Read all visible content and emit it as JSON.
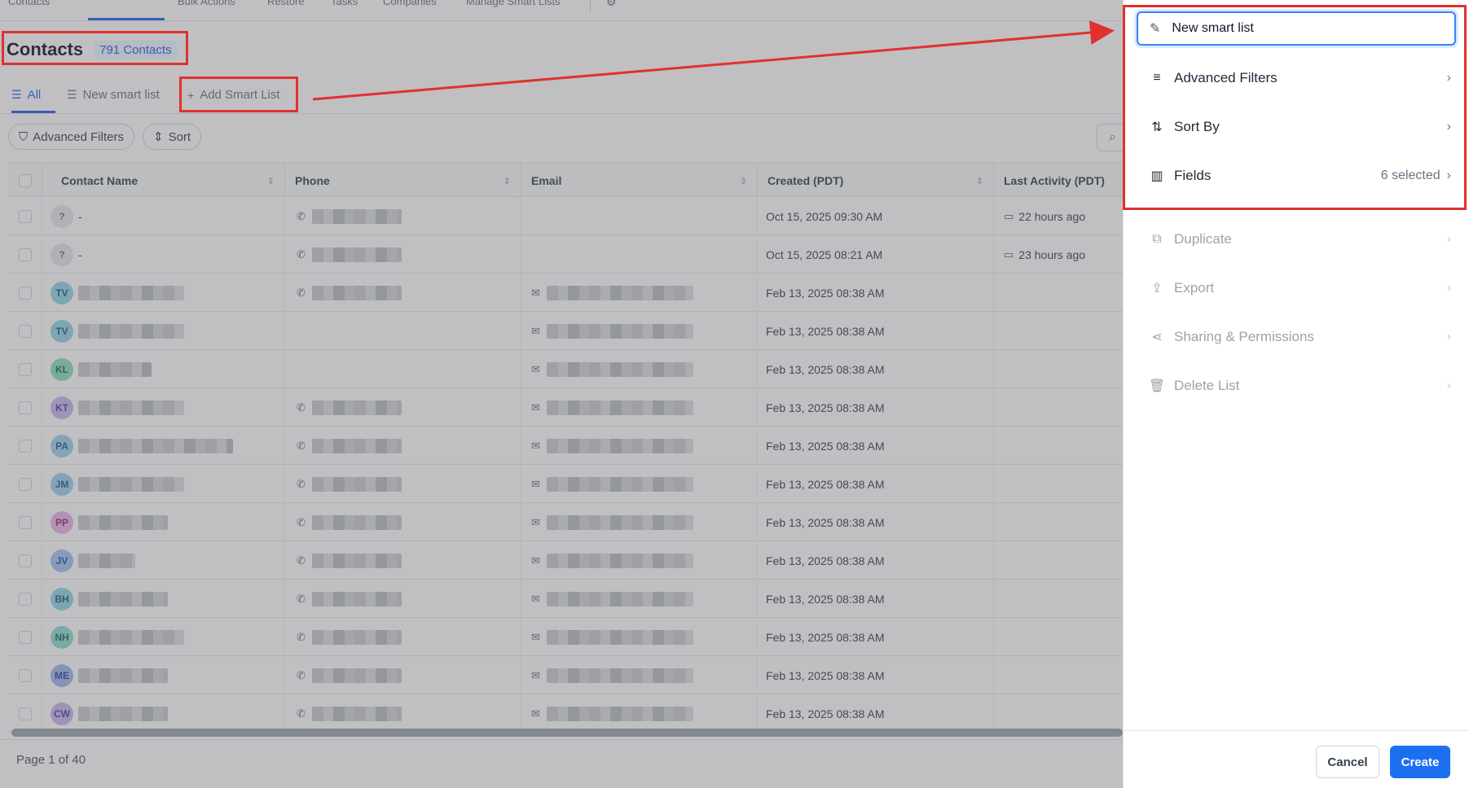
{
  "topnav": {
    "items": [
      "Contacts",
      "Bulk Actions",
      "Restore",
      "Tasks",
      "Companies",
      "Manage Smart Lists"
    ]
  },
  "header": {
    "title": "Contacts",
    "count": "791 Contacts"
  },
  "tabs": [
    {
      "label": "All",
      "icon": "list-icon"
    },
    {
      "label": "New smart list",
      "icon": "list-icon"
    },
    {
      "label": "Add Smart List",
      "icon": "plus-icon"
    }
  ],
  "filters": {
    "advanced": "Advanced Filters",
    "sort": "Sort"
  },
  "table": {
    "columns": [
      "Contact Name",
      "Phone",
      "Email",
      "Created (PDT)",
      "Last Activity (PDT)"
    ],
    "rows": [
      {
        "avatar": "?",
        "name": "-",
        "phone": true,
        "email": false,
        "created": "Oct 15, 2025 09:30 AM",
        "activity": "22 hours ago",
        "color": "#e5e7eb",
        "fg": "#6b7280"
      },
      {
        "avatar": "?",
        "name": "-",
        "phone": true,
        "email": false,
        "created": "Oct 15, 2025 08:21 AM",
        "activity": "23 hours ago",
        "color": "#e5e7eb",
        "fg": "#6b7280"
      },
      {
        "avatar": "TV",
        "name": "",
        "phone": true,
        "email": true,
        "created": "Feb 13, 2025 08:38 AM",
        "activity": "",
        "color": "#93d5e8",
        "fg": "#1e5f74"
      },
      {
        "avatar": "TV",
        "name": "",
        "phone": false,
        "email": true,
        "created": "Feb 13, 2025 08:38 AM",
        "activity": "",
        "color": "#93d5e8",
        "fg": "#1e5f74"
      },
      {
        "avatar": "KL",
        "name": "",
        "phone": false,
        "email": true,
        "created": "Feb 13, 2025 08:38 AM",
        "activity": "",
        "color": "#8fdcc2",
        "fg": "#1c6b52"
      },
      {
        "avatar": "KT",
        "name": "",
        "phone": true,
        "email": true,
        "created": "Feb 13, 2025 08:38 AM",
        "activity": "",
        "color": "#c9b8ee",
        "fg": "#5b3fa0"
      },
      {
        "avatar": "PA",
        "name": "",
        "phone": true,
        "email": true,
        "created": "Feb 13, 2025 08:38 AM",
        "activity": "",
        "color": "#9fd0f0",
        "fg": "#1f5f8b"
      },
      {
        "avatar": "JM",
        "name": "",
        "phone": true,
        "email": true,
        "created": "Feb 13, 2025 08:38 AM",
        "activity": "",
        "color": "#9fd0f0",
        "fg": "#1f5f8b"
      },
      {
        "avatar": "PP",
        "name": "",
        "phone": true,
        "email": true,
        "created": "Feb 13, 2025 08:38 AM",
        "activity": "",
        "color": "#eab5e6",
        "fg": "#8a2f83"
      },
      {
        "avatar": "JV",
        "name": "",
        "phone": true,
        "email": true,
        "created": "Feb 13, 2025 08:38 AM",
        "activity": "",
        "color": "#a3c4f2",
        "fg": "#2c5597"
      },
      {
        "avatar": "BH",
        "name": "",
        "phone": true,
        "email": true,
        "created": "Feb 13, 2025 08:38 AM",
        "activity": "",
        "color": "#93d5e8",
        "fg": "#1e5f74"
      },
      {
        "avatar": "NH",
        "name": "",
        "phone": true,
        "email": true,
        "created": "Feb 13, 2025 08:38 AM",
        "activity": "",
        "color": "#8fdcd2",
        "fg": "#1c6b62"
      },
      {
        "avatar": "ME",
        "name": "",
        "phone": true,
        "email": true,
        "created": "Feb 13, 2025 08:38 AM",
        "activity": "",
        "color": "#a3b8f2",
        "fg": "#2c4597"
      },
      {
        "avatar": "CW",
        "name": "",
        "phone": true,
        "email": true,
        "created": "Feb 13, 2025 08:38 AM",
        "activity": "",
        "color": "#c9b8ee",
        "fg": "#5b3fa0"
      }
    ]
  },
  "pagination": {
    "label": "Page 1 of 40"
  },
  "panel": {
    "name_value": "New smart list",
    "menu": [
      {
        "label": "Advanced Filters",
        "icon": "filter-lines-icon",
        "meta": "",
        "enabled": true
      },
      {
        "label": "Sort By",
        "icon": "sort-arrows-icon",
        "meta": "",
        "enabled": true
      },
      {
        "label": "Fields",
        "icon": "columns-icon",
        "meta": "6 selected",
        "enabled": true
      },
      {
        "label": "Duplicate",
        "icon": "copy-icon",
        "meta": "",
        "enabled": false
      },
      {
        "label": "Export",
        "icon": "upload-icon",
        "meta": "",
        "enabled": false
      },
      {
        "label": "Sharing & Permissions",
        "icon": "share-icon",
        "meta": "",
        "enabled": false
      },
      {
        "label": "Delete List",
        "icon": "trash-icon",
        "meta": "",
        "enabled": false
      }
    ],
    "cancel_label": "Cancel",
    "create_label": "Create"
  },
  "colors": {
    "accent": "#1d6ff2",
    "annotation": "#e0312f"
  }
}
